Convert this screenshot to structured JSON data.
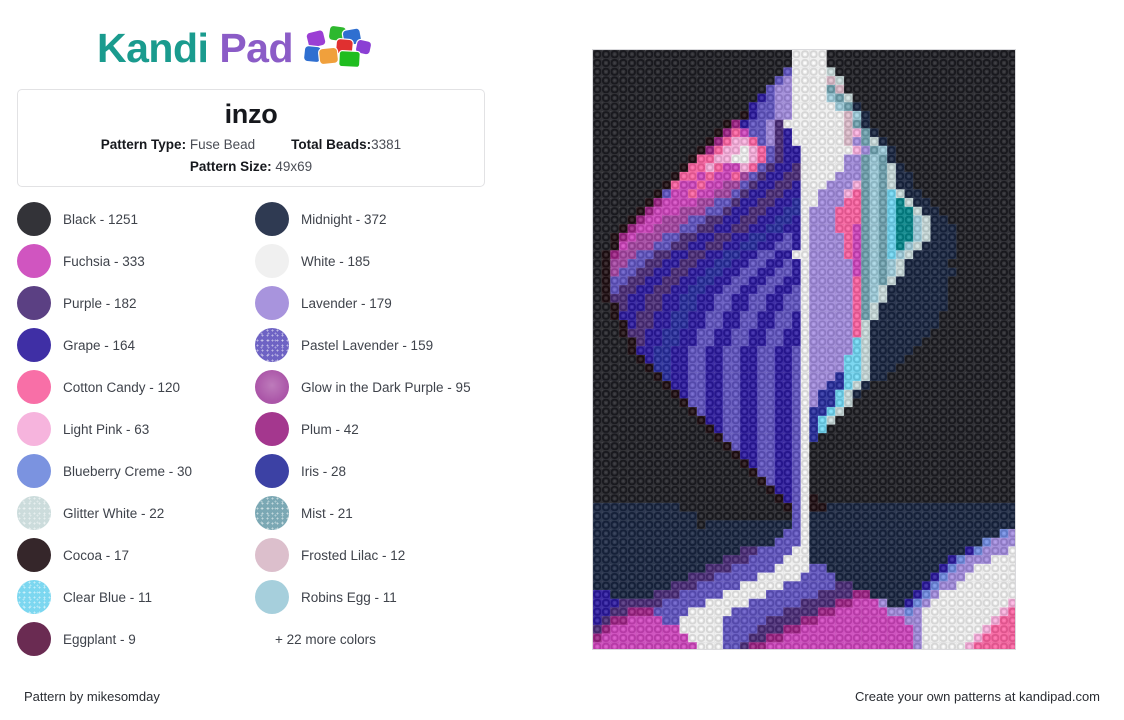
{
  "logo": {
    "text_part1": "Kandi",
    "text_part2": "Pad",
    "teal": "#1a9b8e",
    "purple": "#8b5cc7",
    "bead_icon": "bead-cluster-icon"
  },
  "info_card": {
    "title": "inzo",
    "pattern_type_label": "Pattern Type:",
    "pattern_type_value": "Fuse Bead",
    "total_beads_label": "Total Beads:",
    "total_beads_value": "3381",
    "pattern_size_label": "Pattern Size:",
    "pattern_size_value": "49x69"
  },
  "legend": {
    "more_colors": "+ 22 more colors",
    "items": [
      {
        "name": "Black",
        "count": 1251,
        "label": "Black - 1251",
        "color": "#333338",
        "texture": "plain"
      },
      {
        "name": "Midnight",
        "count": 372,
        "label": "Midnight - 372",
        "color": "#2f3a52",
        "texture": "plain"
      },
      {
        "name": "Fuchsia",
        "count": 333,
        "label": "Fuchsia - 333",
        "color": "#d055c0",
        "texture": "plain"
      },
      {
        "name": "White",
        "count": 185,
        "label": "White - 185",
        "color": "#f0f0f0",
        "texture": "plain"
      },
      {
        "name": "Purple",
        "count": 182,
        "label": "Purple - 182",
        "color": "#5b4083",
        "texture": "plain"
      },
      {
        "name": "Lavender",
        "count": 179,
        "label": "Lavender - 179",
        "color": "#a894dd",
        "texture": "plain"
      },
      {
        "name": "Grape",
        "count": 164,
        "label": "Grape - 164",
        "color": "#3f2fa5",
        "texture": "plain"
      },
      {
        "name": "Pastel Lavender",
        "count": 159,
        "label": "Pastel Lavender - 159",
        "color": "#6e63c4",
        "texture": "speckle"
      },
      {
        "name": "Cotton Candy",
        "count": 120,
        "label": "Cotton Candy - 120",
        "color": "#f86fa7",
        "texture": "plain"
      },
      {
        "name": "Glow in the Dark Purple",
        "count": 95,
        "label": "Glow in the Dark Purple - 95",
        "color": "#ab56a8",
        "texture": "glow"
      },
      {
        "name": "Light Pink",
        "count": 63,
        "label": "Light Pink - 63",
        "color": "#f6b4dd",
        "texture": "plain"
      },
      {
        "name": "Plum",
        "count": 42,
        "label": "Plum - 42",
        "color": "#a4378e",
        "texture": "plain"
      },
      {
        "name": "Blueberry Creme",
        "count": 30,
        "label": "Blueberry Creme - 30",
        "color": "#7b93e0",
        "texture": "plain"
      },
      {
        "name": "Iris",
        "count": 28,
        "label": "Iris - 28",
        "color": "#3c41a4",
        "texture": "plain"
      },
      {
        "name": "Glitter White",
        "count": 22,
        "label": "Glitter White - 22",
        "color": "#ccdcdc",
        "texture": "speckle"
      },
      {
        "name": "Mist",
        "count": 21,
        "label": "Mist - 21",
        "color": "#7ba8b4",
        "texture": "speckle"
      },
      {
        "name": "Cocoa",
        "count": 17,
        "label": "Cocoa - 17",
        "color": "#35262a",
        "texture": "plain"
      },
      {
        "name": "Frosted Lilac",
        "count": 12,
        "label": "Frosted Lilac - 12",
        "color": "#dcbfcc",
        "texture": "plain"
      },
      {
        "name": "Clear Blue",
        "count": 11,
        "label": "Clear Blue - 11",
        "color": "#7cd7f0",
        "texture": "speckle"
      },
      {
        "name": "Robins Egg",
        "count": 11,
        "label": "Robins Egg - 11",
        "color": "#a6cfdc",
        "texture": "plain"
      },
      {
        "name": "Eggplant",
        "count": 9,
        "label": "Eggplant - 9",
        "color": "#6a2b52",
        "texture": "plain"
      }
    ]
  },
  "pattern_image": {
    "alt": "inzo fuse bead pattern preview",
    "cols": 49,
    "rows": 69,
    "background_color": "#333338",
    "palette": {
      "K": "#333338",
      "M": "#2f3a52",
      "F": "#d055c0",
      "W": "#f0f0f0",
      "P": "#5b4083",
      "L": "#a894dd",
      "G": "#3f2fa5",
      "V": "#6e63c4",
      "C": "#f86fa7",
      "D": "#ab56a8",
      "p": "#f6b4dd",
      "U": "#a4378e",
      "B": "#7b93e0",
      "I": "#3c41a4",
      "g": "#ccdcdc",
      "S": "#7ba8b4",
      "o": "#35262a",
      "l": "#dcbfcc",
      "b": "#7cd7f0",
      "r": "#a6cfdc",
      "E": "#6a2b52",
      "t": "#1d8f93",
      "n": "#4a5f8a"
    },
    "rows_data": [
      "KKKKKKKKKKKKKKKKKKKKKKKWWWWKKKKKKKKKKKKKKKKKKKKKK",
      "KKKKKKKKKKKKKKKKKKKKKKKWWWWKKKKKKKKKKKKKKKKKKKKKK",
      "KKKKKKKKKKKKKKKKKKKKKKVWWWWgKKKKKKKKKKKKKKKKKKKKK",
      "KKKKKKKKKKKKKKKKKKKKKVLWWWWlgKKKKKKKKKKKKKKKKKKKK",
      "KKKKKKKKKKKKKKKKKKKKVLLWWWWSlKKKKKKKKKKKKKKKKKKKK",
      "KKKKKKKKKKKKKKKKKKKGVLLWWWWrSgKKKKKKKKKKKKKKKKKKK",
      "KKKKKKKKKKKKKKKKKKGVVLLWWWWWrSMKKKKKKKKKKKKKKKKKK",
      "KKKKKKKKKKKKKKKKKoGVVLLWWWWWWlrMKKKKKKKKKKKKKKKKK",
      "KKKKKKKKKKKKKKKoUGVVLPWWWWWWWlSMKKKKKKKKKKKKKKKKK",
      "KKKKKKKKKKKKKKoUCFVVLPGWWWWWWlpSMKKKKKKKKKKKKKKKK",
      "KKKKKKKKKKKKKoUCppCVLPGWWWWWWlLSgMKKKKKKKKKKKKKKK",
      "KKKKKKKKKKKKoUCppWpCVPGGWWWWWWpLSrMKKKKKKKKKKKKKK",
      "KKKKKKKKKKKoCCppWWpCVPGGWWWWWLLSrSMKKKKKKKKKKKKKK",
      "KKKKKKKKKKoCCpCFFpCVPGGPWWWWWLLSrSgMKKKKKKKKKKKKK",
      "KKKKKKKKKoCCFCFFCDVPGGPPWWWWLLLSrSgMMKKKKKKKKKKKK",
      "KKKKKKKKoCFFCFFDDVPGGPPGWWWLLLpSrSgMMKKKKKKKKKKKK",
      "KKKKKKKoVFFCFFDDVPGGPPGGWWLLLpCSrSbgMMKKKKKKKKKKK",
      "KKKKKKoUFFFFDDVVPGGPPGGIWWLLLCCSrSbtgMMKKKKKKKKKK",
      "KKKKKoUFFFDDDVVPGGPPGGIIWLLLCCCSrSbttgMMKKKKKKKKK",
      "KKKKoUFFDDDVVPPGGPPGGIIGWLLLCCCSrSbttrgMMKKKKKKKK",
      "KKKoUFFDDDVVPPGGPPGGIIGGWLLLCCFSrSbttrgMMMKKKKKKK",
      "KKoUFDDDVVPPGGPPGGIIGGVGWLLLLCFSrSbttrgMMMKKKKKKK",
      "KKoFDDDVVPPGGPPGGIIGGVVGWLLLLCFSrSbtrgMMMMKKKKKKK",
      "KoUDDVVPPGGPPGGIIGGVVGGWWLLLLCFSrSbrgMMMMMKKKKKKK",
      "KoDDVVPPGGPPGGIIGGVVGGVGWLLLLLFSrSrgMMMMMKKKKKKKK",
      "KoDVVPPGGPPGGIIGGVVGGVVGWLLLLLFSrSrgMMMMMMKKKKKKK",
      "KoVVPPGGPPGGIIGGVVGGVVGGWLLLLLCSrSgMMMMMMKKKKKKKK",
      "KoVPPGGPPGGIIGGVVGGVVGGVWLLLLLCSrgMMMMMMMKKKKKKKK",
      "KoPPGGPPGGIIGGVVGGVVGGVVWLLLLLCSrgMMMMMMMKKKKKKKK",
      "KKoPGGPPGGIIGGVVGGVVGGVVWLLLLLCSgMMMMMMMMKKKKKKKK",
      "KKoGGPPGGIIGGVVGGVVGGVVGWLLLLLCSgMMMMMMMKKKKKKKKK",
      "KKKoGPPGGIIGGVVGGVVGGVVGWLLLLLCgMMMMMMMMKKKKKKKKK",
      "KKKoPPGGIIGGVVGGVVGGVVGGWLLLLLCgMMMMMMMKKKKKKKKKK",
      "KKKKoPGGIIGGVVGGVVGGVVGGWLLLLLbgMMMMMMKKKKKKKKKKK",
      "KKKKoGGIIGGVVGGVVGGVVGGVWLLLLLbgMMMMMKKKKKKKKKKKK",
      "KKKKKoGIIGGVVGGVVGGVVGGVWLLLLbbgMMMMKKKKKKKKKKKKK",
      "KKKKKKoIIGGVVGGVVGGVVGGVWLLLLbbgMMMKKKKKKKKKKKKKK",
      "KKKKKKKoIGGVVGGVVGGVVGGVWLLLIbbgMMKKKKKKKKKKKKKKK",
      "KKKKKKKKoGGVVGGVVGGVVGGVWLLIIbgMKKKKKKKKKKKKKKKKK",
      "KKKKKKKKKoGVVGGVVGGVVGGVWLIIbgMKKKKKKKKKKKKKKKKKK",
      "KKKKKKKKKKoVVGGVVGGVVGGVWLIIbgKKKKKKKKKKKKKKKKKKK",
      "KKKKKKKKKKKoVGGVVGGVVGGVWIIbgKKKKKKKKKKKKKKKKKKKK",
      "KKKKKKKKKKKKoGGVVGGVVGGVWIbgKKKKKKKKKKKKKKKKKKKKK",
      "KKKKKKKKKKKKKoGVVGGVVGGVWIbKKKKKKKKKKKKKKKKKKKKKK",
      "KKKKKKKKKKKKKKoVVGGVVGGVWIKKKKKKKKKKKKKKKKKKKKKKK",
      "KKKKKKKKKKKKKKKoVGGVVGGVWKKKKKKKKKKKKKKKKKKKKKKKK",
      "KKKKKKKKKKKKKKKKoGGVVGGVWKKKKKKKKKKKKKKKKKKKKKKKK",
      "KKKKKKKKKKKKKKKKKoGVVGGVWKKKKKKKKKKKKKKKKKKKKKKKK",
      "KKKKKKKKKKKKKKKKKKoVVGGVWKKKKKKKKKKKKKKKKKKKKKKKK",
      "KKKKKKKKKKKKKKKKKKKoVGGVWKKKKKKKKKKKKKKKKKKKKKKKK",
      "KKKKKKKKKKKKKKKKKKKKoGGVWKKKKKKKKKKKKKKKKKKKKKKKK",
      "KKKKKKKKKKKKKKKKKKKKKoGVWoKKKKKKKKKKKKKKKKKKKKKKK",
      "MMMMMMMMMMKKKKKKKKKKKKoVWooMMMMMMMMMMMMMMMMMMMMMM",
      "MMMMMMMMMMMMKKKKKKKKKKKVWMMMMMMMMMMMMMMMMMMMMMMMM",
      "MMMMMMMMMMMMKMMMMMMMMMMVWMMMMMMMMMMMMMMMMMMMMMMMM",
      "MMMMMMMMMMMMMMMMMMMMMMVVWMMMMMMMMMMMMMMMMMMMMMMBL",
      "MMMMMMMMMMMMMMMMMMMMMVVVWMMMMMMMMMMMMMMMMMMMMBLLL",
      "MMMMMMMMMMMMMMMMMPPVVVVWWMMMMMMMMMMMMMMMMMMGBLLLW",
      "MMMMMMMMMMMMMMMPPPVVVVWWWMMMMMMMMMMMMMMMMGBLLLWWW",
      "MMMMMMMMMMMMMPPPVVVVVWWWWVVMMMMMMMMMMMMMGBLLWWWWW",
      "MMMMMMMMMMMPPPVVVVVWWWWWVVVVMMMMMMMMMMMGBLLWWWWWW",
      "MMMMMMMMMPPPVVVVVWWWWWVVVVVVPPMMMMMMMMGBLLWWWWWWW",
      "GGMMMMMPPPVVVVVWWWWWVVVVVVPPPPUUMMMMMGBLWWWWWWWWW",
      "GGGPPPPPVVVVVWWWWWVVVVVVPPPPUUFFFLMMGBLWWWWWWWWWp",
      "GGPPUUUVVVVWWWWWVVVVVVPPPPUUFFFFFFLLBLWWWWWWWWWpC",
      "GPUUFFFFVVWWWWWVVVVVPPPPUUFFFFFFFFFFLLWWWWWWWWpCC",
      "PUFFFFFFFFWWWWWVVVVPPPUUFFFFFFFFFFFFFLWWWWWWWpCCC",
      "UFFFFFFFFFFWWWWVVVPPUUFFFFFFFFFFFFFFFLWWWWWWpCCCC",
      "FFFFFFFFFFFFWWWVVPUUFFFFFFFFFFFFFFFFFLWWWWWpCCCCC",
      "FFFFFFFFFFFFFWWVPUUFFFFFFFFFFFFFFFFFFLWWWWpCCCCCC"
    ]
  },
  "footer": {
    "left": "Pattern by mikesomday",
    "right": "Create your own patterns at kandipad.com"
  }
}
